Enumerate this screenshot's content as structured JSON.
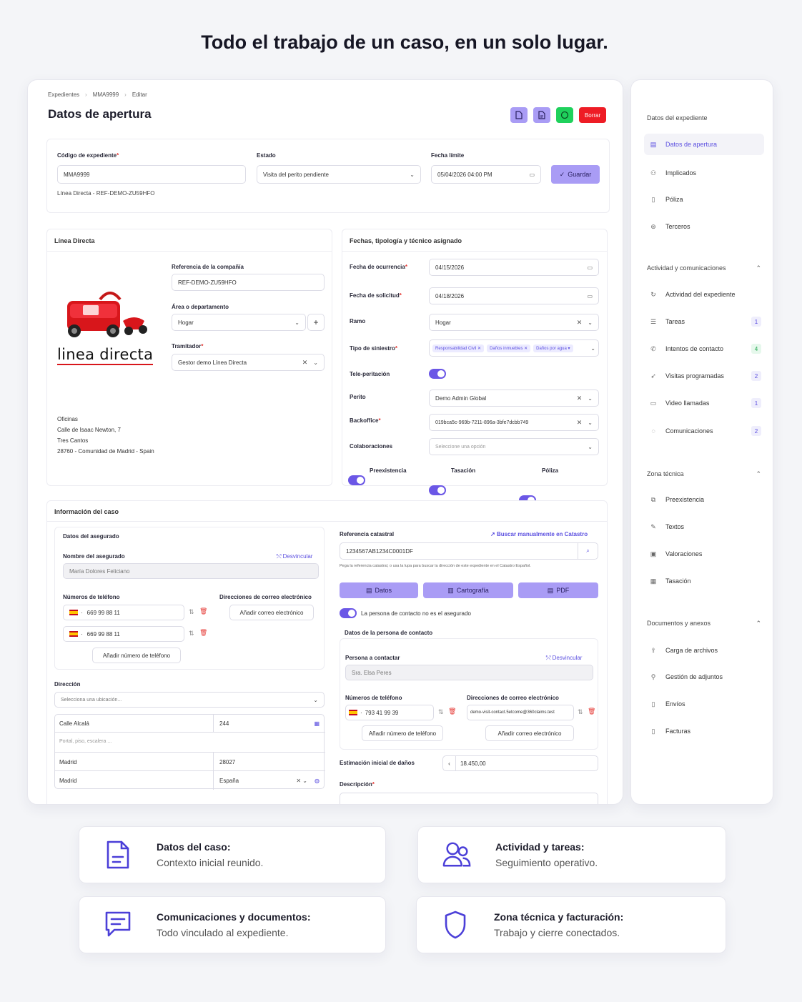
{
  "headline": "Todo el trabajo de un caso, en un solo lugar.",
  "breadcrumb": [
    "Expedientes",
    "MMA9999",
    "Editar"
  ],
  "page_title": "Datos de apertura",
  "toolbar": {
    "delete_label": "Borrar"
  },
  "top_form": {
    "codigo_label": "Código de expediente",
    "codigo_value": "MMA9999",
    "codigo_sub": "Línea Directa - REF-DEMO-ZU59HFO",
    "estado_label": "Estado",
    "estado_value": "Visita del perito pendiente",
    "fecha_label": "Fecha límite",
    "fecha_value": "05/04/2026 04:00 PM",
    "save_label": "Guardar"
  },
  "company": {
    "section_title": "Línea Directa",
    "logo_text": "linea directa",
    "ref_label": "Referencia de la compañía",
    "ref_value": "REF-DEMO-ZU59HFO",
    "area_label": "Área o departamento",
    "area_value": "Hogar",
    "tram_label": "Tramitador",
    "tram_value": "Gestor demo Línea Directa",
    "office_title": "Oficinas",
    "office_lines": [
      "Calle de Isaac Newton, 7",
      "Tres Cantos",
      "28760 - Comunidad de Madrid - Spain"
    ]
  },
  "fechas": {
    "section_title": "Fechas, tipología y técnico asignado",
    "ocurrencia_label": "Fecha de ocurrencia",
    "ocurrencia_value": "04/15/2026",
    "solicitud_label": "Fecha de solicitud",
    "solicitud_value": "04/18/2026",
    "ramo_label": "Ramo",
    "ramo_value": "Hogar",
    "tipo_label": "Tipo de siniestro",
    "tipo_tags": [
      "Responsabilidad Civil",
      "Daños inmuebles",
      "Daños por agua"
    ],
    "tele_label": "Tele-peritación",
    "perito_label": "Perito",
    "perito_value": "Demo Admin Global",
    "backoffice_label": "Backoffice",
    "backoffice_value": "019bca5c-969b-7211-896a-3bfe7dcbb749",
    "colab_label": "Colaboraciones",
    "colab_placeholder": "Seleccione una opción",
    "toggles": [
      "Preexistencia",
      "Tasación",
      "Póliza"
    ]
  },
  "caso": {
    "section_title": "Información del caso",
    "asegurado_title": "Datos del asegurado",
    "nombre_label": "Nombre del asegurado",
    "desvincular": "Desvincular",
    "nombre_value": "María Dolores Feliciano",
    "tel_label": "Números de teléfono",
    "email_label": "Direcciones de correo electrónico",
    "phones": [
      "669 99 88 11",
      "669 99 88 11"
    ],
    "add_email": "Añadir correo electrónico",
    "add_phone": "Añadir número de teléfono",
    "dir_label": "Dirección",
    "dir_placeholder": "Selecciona una ubicación...",
    "calle": "Calle Alcalá",
    "numero": "244",
    "piso_placeholder": "Portal, piso, escalera ...",
    "ciudad": "Madrid",
    "cp": "28027",
    "provincia": "Madrid",
    "pais": "España",
    "catastro_label": "Referencia catastral",
    "catastro_link": "Buscar manualmente en Catastro",
    "catastro_value": "1234567AB1234C0001DF",
    "catastro_help": "Pega la referencia catastral, o usa la lupa para buscar la dirección de este expediente en el Catastro Español.",
    "btn_datos": "Datos",
    "btn_carto": "Cartografía",
    "btn_pdf": "PDF",
    "contact_toggle": "La persona de contacto no es el asegurado",
    "contact_title": "Datos de la persona de contacto",
    "persona_label": "Persona a contactar",
    "persona_value": "Sra. Elsa Peres",
    "contact_phone": "793 41 99 39",
    "contact_email": "demo-visit-contact.5etcome@360claims.test",
    "estimacion_label": "Estimación inicial de daños",
    "estimacion_value": "18.450,00",
    "descripcion_label": "Descripción"
  },
  "sidebar": {
    "g1_title": "Datos del expediente",
    "g1_items": [
      "Datos de apertura",
      "Implicados",
      "Póliza",
      "Terceros"
    ],
    "g2_title": "Actividad y comunicaciones",
    "g2_items": [
      {
        "label": "Actividad del expediente"
      },
      {
        "label": "Tareas",
        "count": "1"
      },
      {
        "label": "Intentos de contacto",
        "count": "4"
      },
      {
        "label": "Visitas programadas",
        "count": "2"
      },
      {
        "label": "Video llamadas",
        "count": "1"
      },
      {
        "label": "Comunicaciones",
        "count": "2"
      }
    ],
    "g3_title": "Zona técnica",
    "g3_items": [
      "Preexistencia",
      "Textos",
      "Valoraciones",
      "Tasación"
    ],
    "g4_title": "Documentos y anexos",
    "g4_items": [
      "Carga de archivos",
      "Gestión de adjuntos",
      "Envíos",
      "Facturas"
    ]
  },
  "features": [
    {
      "title": "Datos del caso:",
      "desc": "Contexto inicial reunido."
    },
    {
      "title": "Actividad y tareas:",
      "desc": "Seguimiento operativo."
    },
    {
      "title": "Comunicaciones y documentos:",
      "desc": "Todo vinculado al expediente."
    },
    {
      "title": "Zona técnica y facturación:",
      "desc": "Trabajo y cierre conectados."
    }
  ],
  "colors": {
    "accent": "#6b57e6",
    "button": "#a99cf5",
    "green": "#1fd15c",
    "red": "#ee1c25"
  }
}
